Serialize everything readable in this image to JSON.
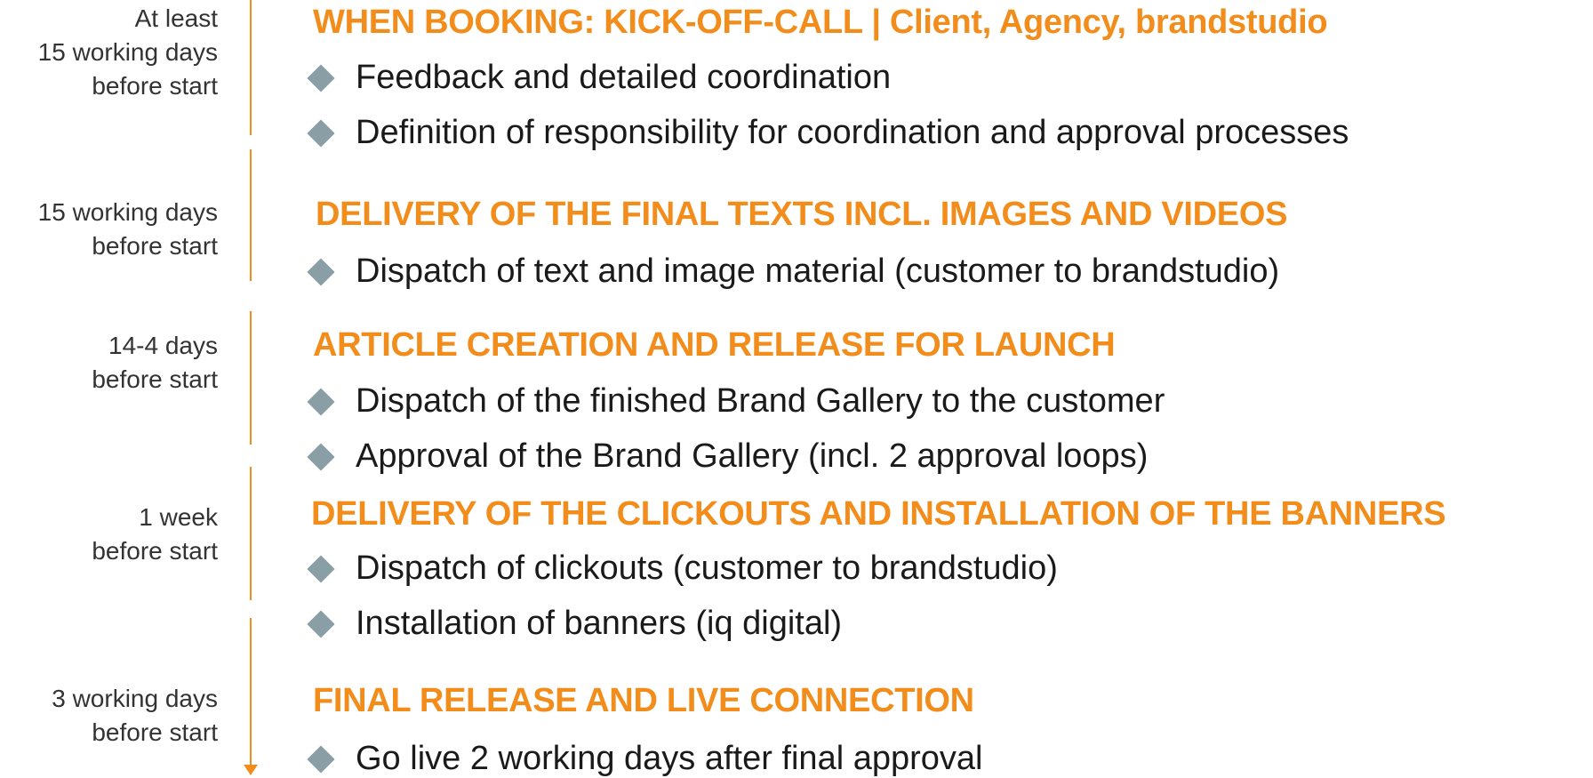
{
  "colors": {
    "accent": "#f28c1a",
    "bullet": "#8a9ea6",
    "text": "#1a1a1a",
    "timing_text": "#333333"
  },
  "icons": {
    "bullet": "diamond-bullet-icon",
    "arrow": "arrow-down-icon"
  },
  "steps": [
    {
      "timing": [
        "At least",
        "15 working days",
        "before start"
      ],
      "heading": "WHEN BOOKING: KICK-OFF-CALL | Client, Agency, brandstudio",
      "bullets": [
        "Feedback and detailed coordination",
        "Definition of responsibility for coordination and approval processes"
      ]
    },
    {
      "timing": [
        "15 working days",
        "before start"
      ],
      "heading": "DELIVERY OF THE FINAL TEXTS INCL. IMAGES AND VIDEOS",
      "bullets": [
        "Dispatch of text and image material (customer to brandstudio)"
      ]
    },
    {
      "timing": [
        "14-4 days",
        "before start"
      ],
      "heading": "ARTICLE CREATION AND RELEASE FOR LAUNCH",
      "bullets": [
        "Dispatch of the finished Brand Gallery to the customer",
        "Approval of the Brand Gallery (incl. 2 approval loops)"
      ]
    },
    {
      "timing": [
        "1 week",
        "before start"
      ],
      "heading": "DELIVERY OF THE CLICKOUTS AND INSTALLATION OF THE BANNERS",
      "bullets": [
        "Dispatch of clickouts (customer to brandstudio)",
        "Installation of banners (iq digital)"
      ]
    },
    {
      "timing": [
        "3 working days",
        "before start"
      ],
      "heading": "FINAL RELEASE AND LIVE CONNECTION",
      "bullets": [
        "Go live 2 working days after final approval"
      ]
    }
  ]
}
